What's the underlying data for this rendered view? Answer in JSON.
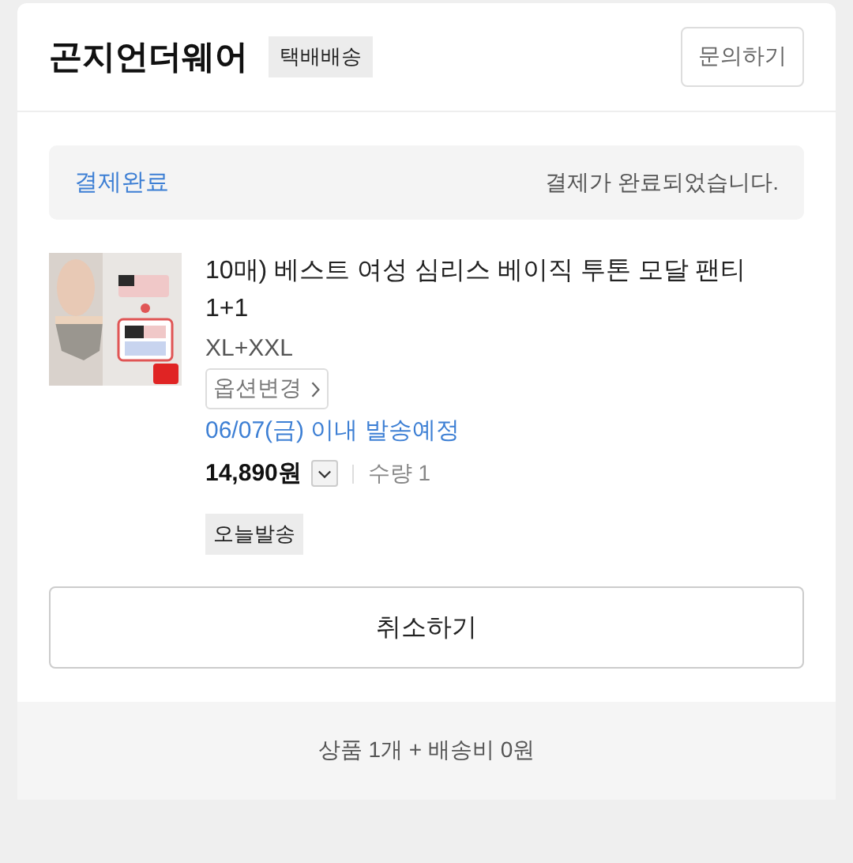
{
  "header": {
    "seller": "곤지언더웨어",
    "delivery_tag": "택배배송",
    "inquiry_button": "문의하기"
  },
  "status": {
    "label": "결제완료",
    "message": "결제가 완료되었습니다."
  },
  "product": {
    "title_lines": [
      "10매) 베스트 여성 심리스 베이직 투톤 모달 팬티",
      "1+1"
    ],
    "option": "XL+XXL",
    "option_change_button": "옵션변경",
    "shipping_estimate": "06/07(금) 이내 발송예정",
    "price": "14,890원",
    "price_detail_expanded": false,
    "quantity": "수량 1",
    "badge": "오늘발송"
  },
  "cancel_button": "취소하기",
  "summary": "상품 1개 + 배송비 0원"
}
